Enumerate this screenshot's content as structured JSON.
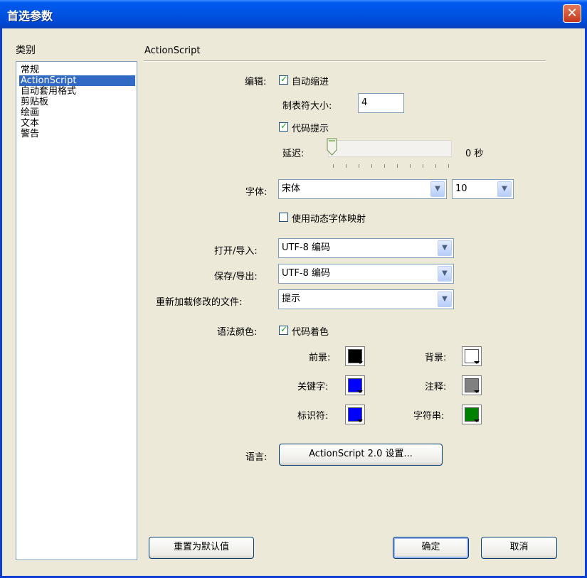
{
  "window": {
    "title": "首选参数",
    "close": "✕"
  },
  "category": {
    "label": "类别",
    "items": [
      "常规",
      "ActionScript",
      "自动套用格式",
      "剪贴板",
      "绘画",
      "文本",
      "警告"
    ],
    "selected": "ActionScript"
  },
  "section": {
    "title": "ActionScript"
  },
  "edit": {
    "label": "编辑:",
    "auto_indent": {
      "label": "自动缩进",
      "checked": true
    },
    "tab_size_label": "制表符大小:",
    "tab_size_value": "4",
    "code_hints": {
      "label": "代码提示",
      "checked": true
    },
    "delay_label": "延迟:",
    "delay_value": "0 秒",
    "delay_level": 0
  },
  "font": {
    "label": "字体:",
    "family": "宋体",
    "size": "10",
    "dynamic_mapping": {
      "label": "使用动态字体映射",
      "checked": false
    }
  },
  "open_import": {
    "label": "打开/导入:",
    "value": "UTF-8 编码"
  },
  "save_export": {
    "label": "保存/导出:",
    "value": "UTF-8 编码"
  },
  "reload": {
    "label": "重新加载修改的文件:",
    "value": "提示"
  },
  "syntax_color": {
    "label": "语法颜色:",
    "code_coloring": {
      "label": "代码着色",
      "checked": true
    },
    "foreground": {
      "label": "前景:",
      "color": "#000000"
    },
    "background": {
      "label": "背景:",
      "color": "#FFFFFF"
    },
    "keyword": {
      "label": "关键字:",
      "color": "#0000FF"
    },
    "comment": {
      "label": "注释:",
      "color": "#808080"
    },
    "identifier": {
      "label": "标识符:",
      "color": "#0000FF"
    },
    "string": {
      "label": "字符串:",
      "color": "#008000"
    }
  },
  "language": {
    "label": "语言:",
    "button": "ActionScript 2.0 设置..."
  },
  "buttons": {
    "reset": "重置为默认值",
    "ok": "确定",
    "cancel": "取消"
  }
}
